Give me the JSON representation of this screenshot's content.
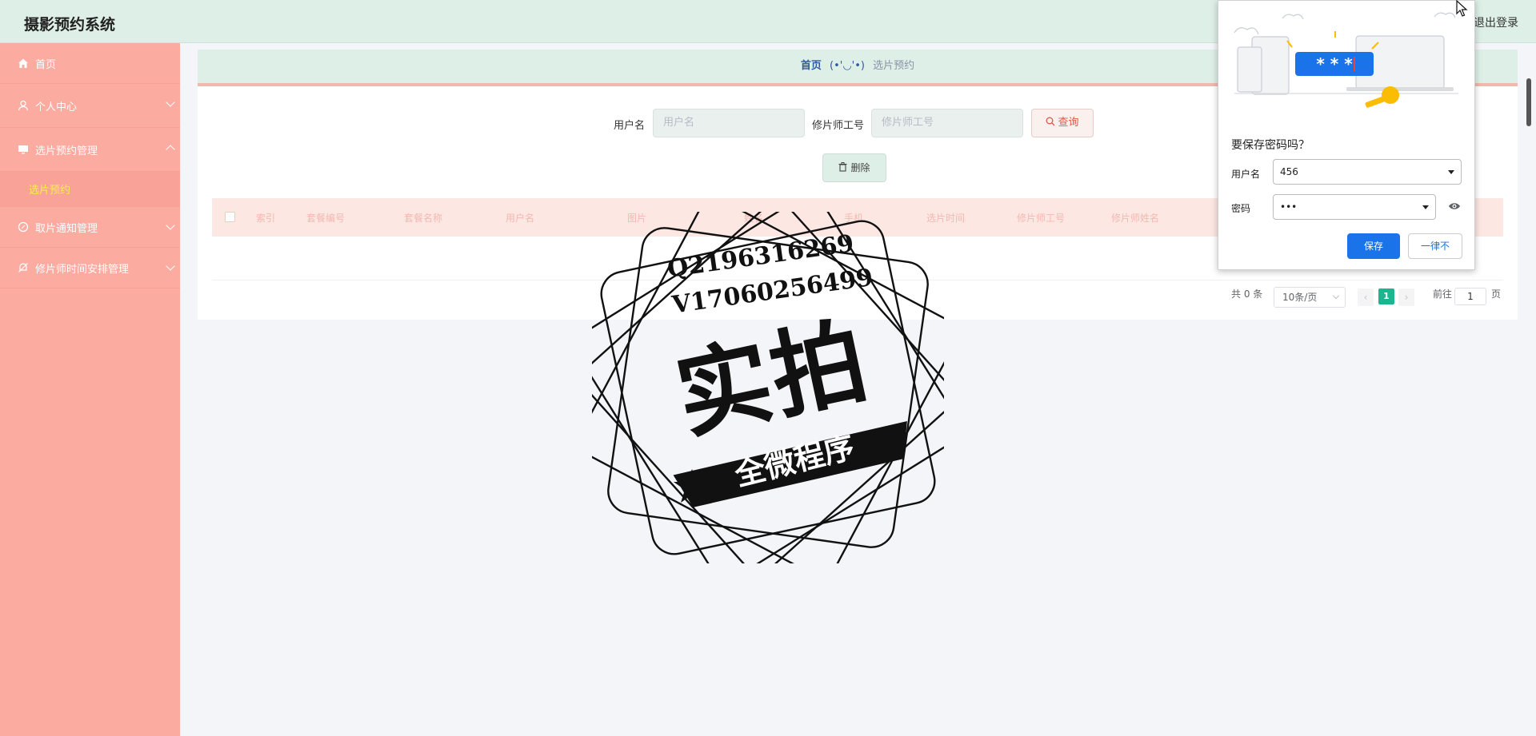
{
  "app": {
    "title": "摄影预约系统",
    "logout_label": "退出登录"
  },
  "sidebar": {
    "items": [
      {
        "label": "首页"
      },
      {
        "label": "个人中心"
      },
      {
        "label": "选片预约管理"
      },
      {
        "label": "取片通知管理"
      },
      {
        "label": "修片师时间安排管理"
      }
    ],
    "subitem": {
      "label": "选片预约"
    }
  },
  "breadcrumb": {
    "home": "首页",
    "face": "(•'◡'•)",
    "current": "选片预约"
  },
  "search": {
    "username_label": "用户名",
    "username_placeholder": "用户名",
    "retoucher_label": "修片师工号",
    "retoucher_placeholder": "修片师工号",
    "query_label": "查询"
  },
  "actions": {
    "delete_label": "删除"
  },
  "table": {
    "headers": [
      "索引",
      "套餐编号",
      "套餐名称",
      "用户名",
      "图片",
      "姓名",
      "手机",
      "选片时间",
      "修片师工号",
      "修片师姓名"
    ]
  },
  "pagination": {
    "total": "共 0 条",
    "page_size": "10条/页",
    "current_page": "1",
    "goto_label": "前往",
    "goto_value": "1",
    "page_suffix": "页"
  },
  "watermark": {
    "line1": "Q2196316269",
    "line2": "V17060256499",
    "big": "实拍",
    "banner": "全微程序"
  },
  "password_popup": {
    "title": "要保存密码吗？",
    "username_label": "用户名",
    "username_value": "456",
    "password_label": "密码",
    "password_value": "•••",
    "save_label": "保存",
    "never_label": "一律不"
  },
  "colors": {
    "sidebar": "#fbaba0",
    "topbar": "#deefe7",
    "accent": "#1bb58f",
    "primary": "#1a73e8"
  }
}
